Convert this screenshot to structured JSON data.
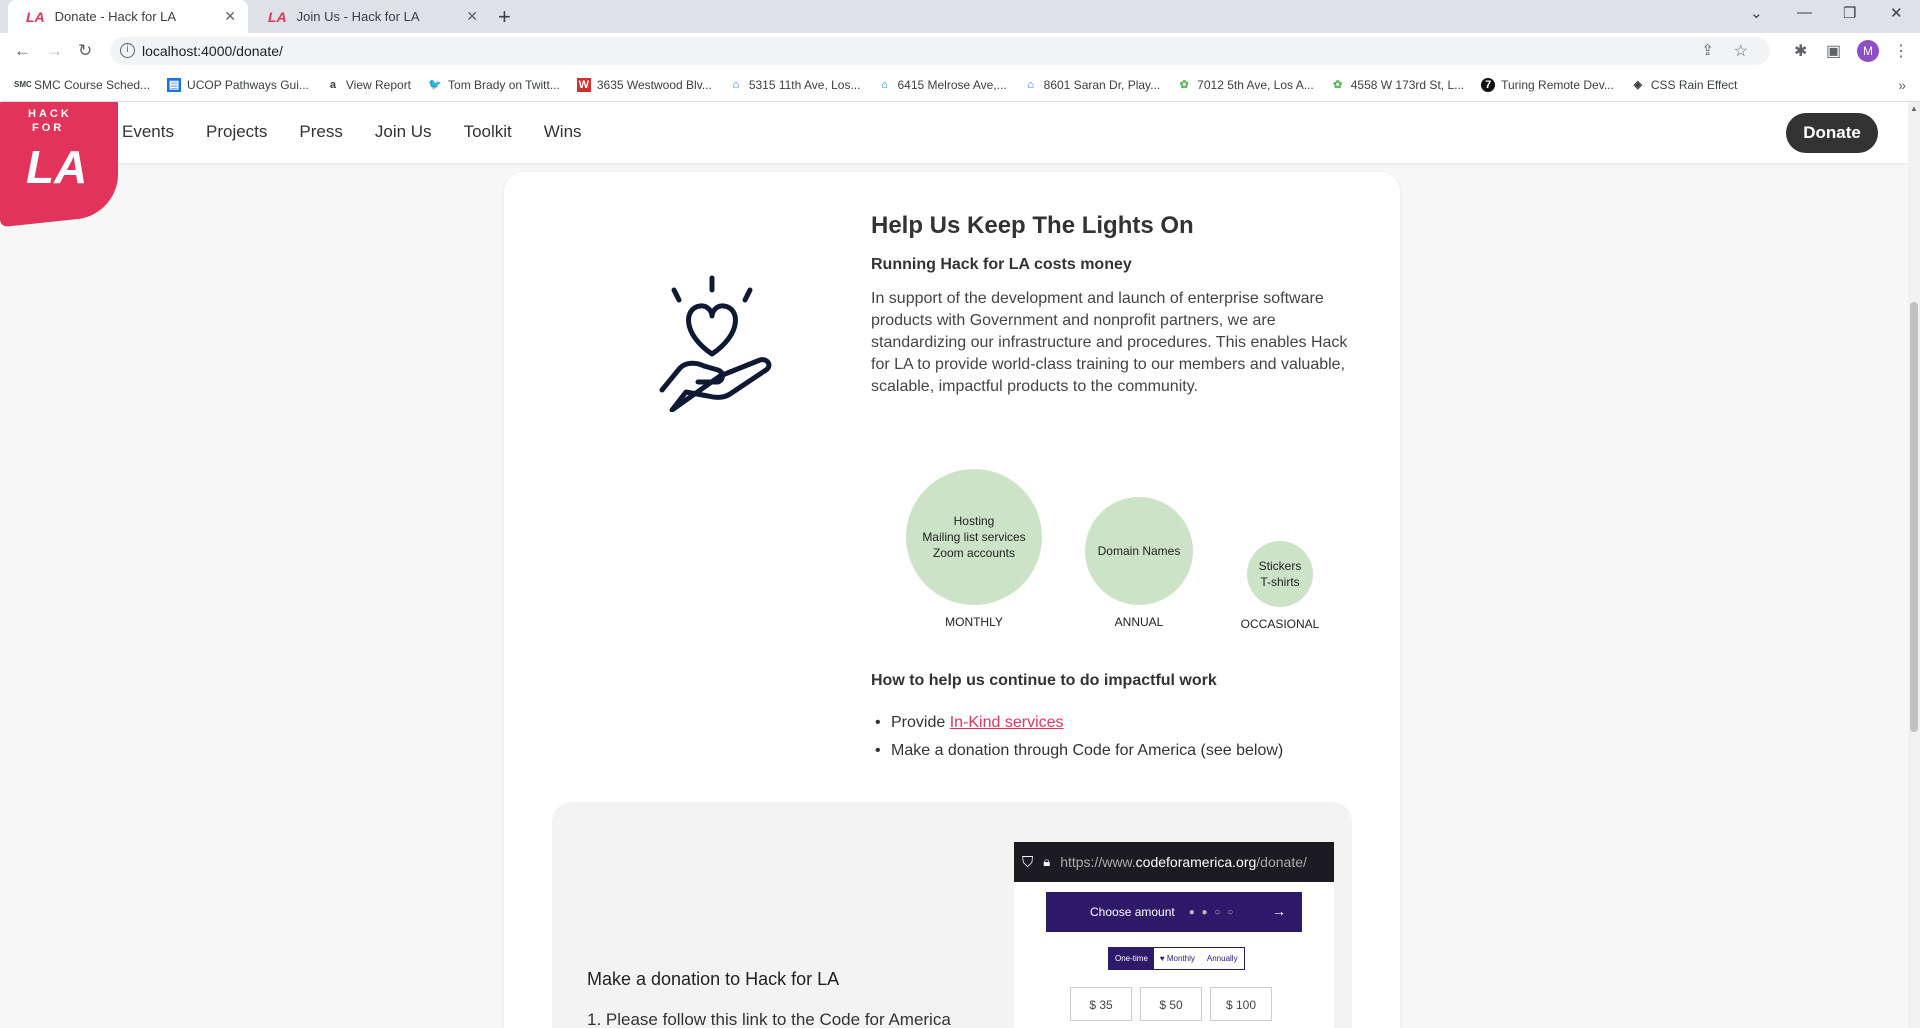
{
  "browser": {
    "tabs": [
      {
        "label": "Donate - Hack for LA",
        "favicon": "LA"
      },
      {
        "label": "Join Us - Hack for LA",
        "favicon": "LA"
      }
    ],
    "url": "localhost:4000/donate/",
    "avatar_letter": "M",
    "bookmarks": [
      {
        "label": "SMC Course Sched...",
        "icon": "SMC"
      },
      {
        "label": "UCOP Pathways Gui...",
        "icon": "UC"
      },
      {
        "label": "View Report",
        "icon": "a"
      },
      {
        "label": "Tom Brady on Twitt...",
        "icon": "twitter"
      },
      {
        "label": "3635 Westwood Blv...",
        "icon": "W"
      },
      {
        "label": "5315 11th Ave, Los...",
        "icon": "zillow"
      },
      {
        "label": "6415 Melrose Ave,...",
        "icon": "zillow"
      },
      {
        "label": "8601 Saran Dr, Play...",
        "icon": "zillow"
      },
      {
        "label": "7012 5th Ave, Los A...",
        "icon": "redfin"
      },
      {
        "label": "4558 W 173rd St, L...",
        "icon": "redfin"
      },
      {
        "label": "Turing Remote Dev...",
        "icon": "T"
      },
      {
        "label": "CSS Rain Effect",
        "icon": "codepen"
      }
    ]
  },
  "site": {
    "logo_line1": "HACK",
    "logo_line2": "FOR",
    "logo_la": "LA",
    "nav": [
      "Events",
      "Projects",
      "Press",
      "Join Us",
      "Toolkit",
      "Wins"
    ],
    "donate_label": "Donate"
  },
  "main": {
    "title": "Help Us Keep The Lights On",
    "subtitle": "Running Hack for LA costs money",
    "paragraph": "In support of the development and launch of enterprise software products with Government and nonprofit partners, we are standardizing our infrastructure and procedures. This enables Hack for LA to provide world-class training to our members and valuable, scalable, impactful products to the community.",
    "bubbles": [
      {
        "lines": [
          "Hosting",
          "Mailing list services",
          "Zoom accounts"
        ],
        "label": "MONTHLY"
      },
      {
        "lines": [
          "Domain Names"
        ],
        "label": "ANNUAL"
      },
      {
        "lines": [
          "Stickers",
          "T-shirts"
        ],
        "label": "OCCASIONAL"
      }
    ],
    "help_title": "How to help us continue to do impactful work",
    "help_item1_prefix": "Provide ",
    "help_item1_link": "In-Kind services",
    "help_item2": "Make a donation through Code for America (see below)"
  },
  "donate_panel": {
    "title": "Make a donation to Hack for LA",
    "step1": "1. Please follow this link to the Code for America",
    "screenshot": {
      "url_prefix": "https://www.",
      "url_domain": "codeforamerica.org",
      "url_path": "/donate/",
      "choose_label": "Choose amount",
      "frequencies": [
        "One-time",
        "♥ Monthly",
        "Annually"
      ],
      "amounts": [
        "$ 35",
        "$ 50",
        "$ 100"
      ]
    }
  }
}
